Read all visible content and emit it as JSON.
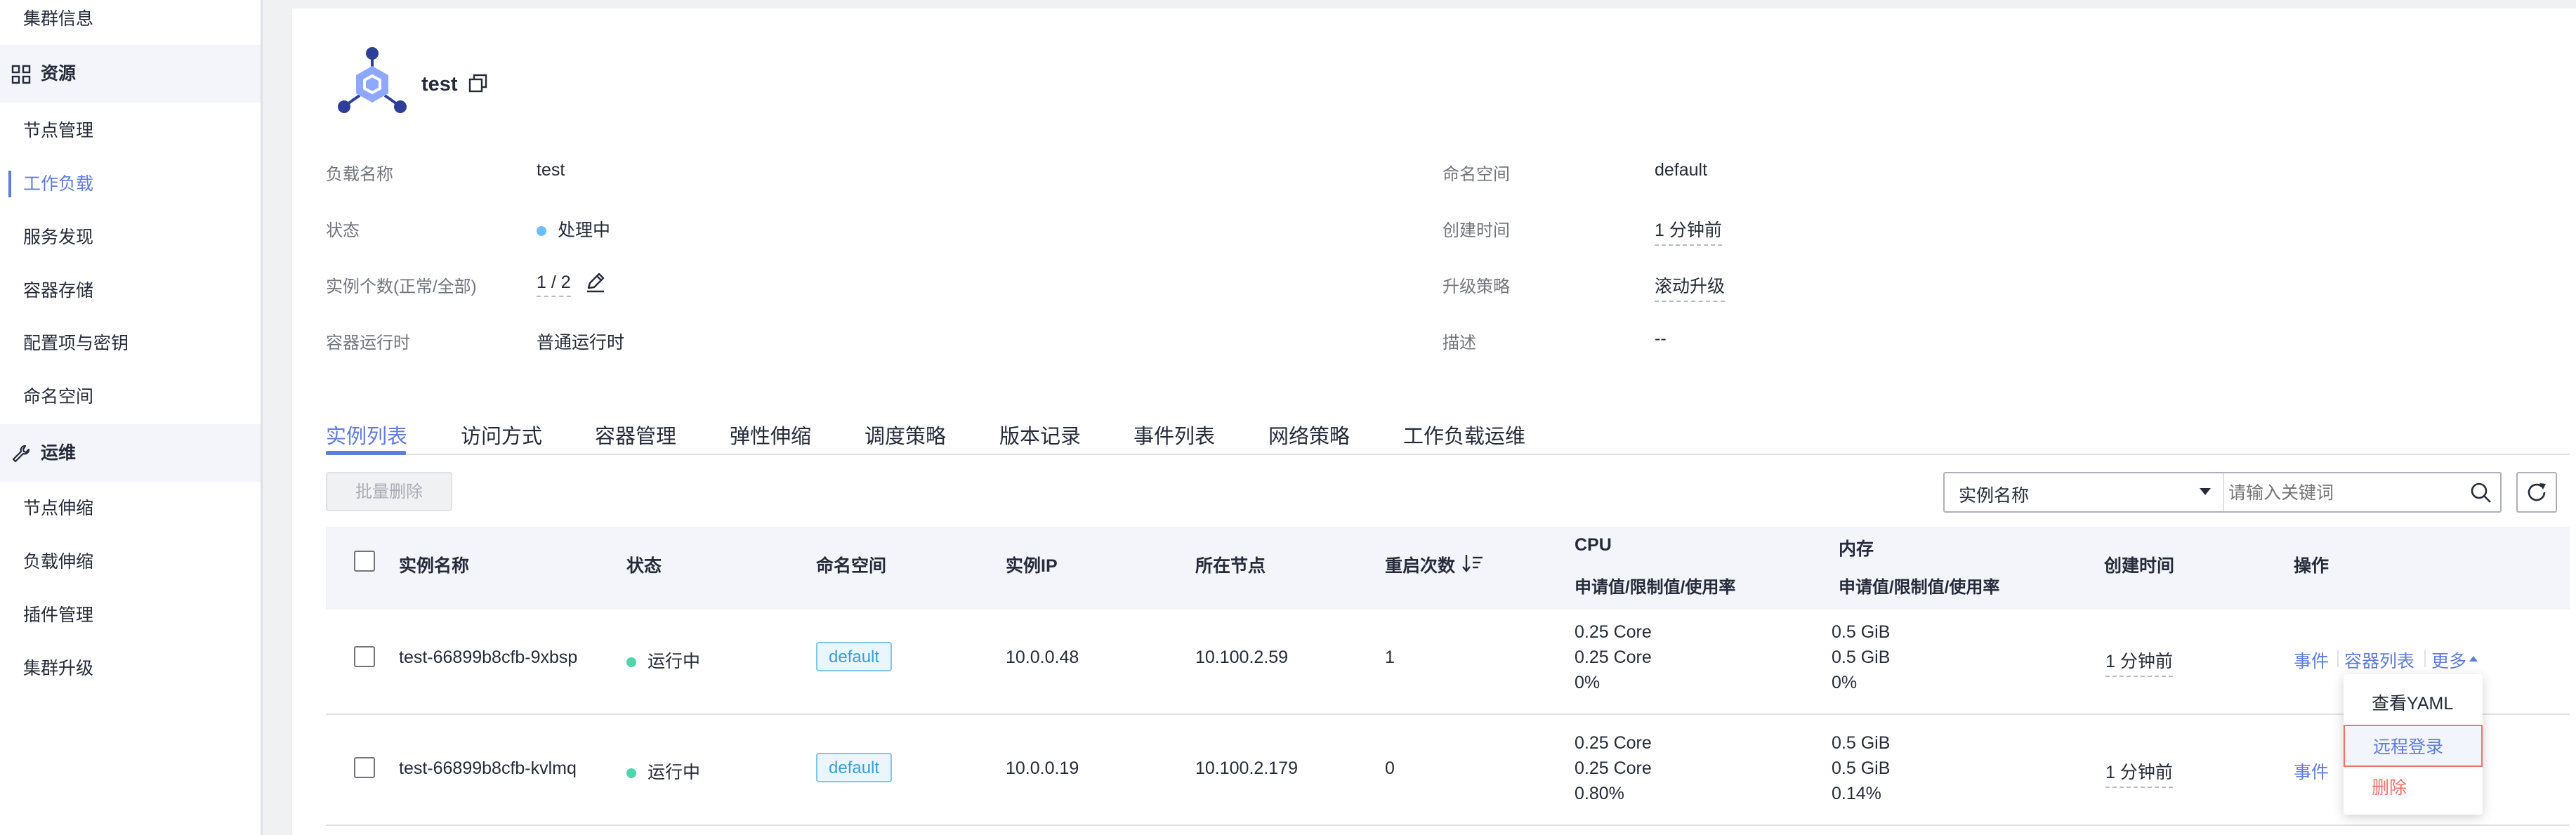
{
  "sidebar": {
    "cluster_info": "集群信息",
    "resources_group": "资源",
    "resources_items": [
      "节点管理",
      "工作负载",
      "服务发现",
      "容器存储",
      "配置项与密钥",
      "命名空间"
    ],
    "ops_group": "运维",
    "ops_items": [
      "节点伸缩",
      "负载伸缩",
      "插件管理",
      "集群升级"
    ]
  },
  "workload": {
    "name": "test",
    "fields": {
      "load_name_label": "负载名称",
      "load_name": "test",
      "status_label": "状态",
      "status": "处理中",
      "instances_label": "实例个数(正常/全部)",
      "instances": "1 / 2",
      "runtime_label": "容器运行时",
      "runtime": "普通运行时",
      "namespace_label": "命名空间",
      "namespace": "default",
      "created_label": "创建时间",
      "created": "1 分钟前",
      "upgrade_label": "升级策略",
      "upgrade": "滚动升级",
      "desc_label": "描述",
      "desc": "--"
    }
  },
  "tabs": [
    "实例列表",
    "访问方式",
    "容器管理",
    "弹性伸缩",
    "调度策略",
    "版本记录",
    "事件列表",
    "网络策略",
    "工作负载运维"
  ],
  "toolbar": {
    "batch_delete": "批量删除",
    "search_type": "实例名称",
    "search_placeholder": "请输入关键词"
  },
  "table": {
    "headers": {
      "name": "实例名称",
      "status": "状态",
      "namespace": "命名空间",
      "ip": "实例IP",
      "node": "所在节点",
      "restarts": "重启次数",
      "cpu": "CPU",
      "cpu_sub": "申请值/限制值/使用率",
      "mem": "内存",
      "mem_sub": "申请值/限制值/使用率",
      "created": "创建时间",
      "actions": "操作"
    },
    "rows": [
      {
        "name": "test-66899b8cfb-9xbsp",
        "status": "运行中",
        "namespace": "default",
        "ip": "10.0.0.48",
        "node": "10.100.2.59",
        "restarts": "1",
        "cpu": [
          "0.25 Core",
          "0.25 Core",
          "0%"
        ],
        "mem": [
          "0.5 GiB",
          "0.5 GiB",
          "0%"
        ],
        "created": "1 分钟前",
        "actions": [
          "事件",
          "容器列表",
          "更多"
        ]
      },
      {
        "name": "test-66899b8cfb-kvlmq",
        "status": "运行中",
        "namespace": "default",
        "ip": "10.0.0.19",
        "node": "10.100.2.179",
        "restarts": "0",
        "cpu": [
          "0.25 Core",
          "0.25 Core",
          "0.80%"
        ],
        "mem": [
          "0.5 GiB",
          "0.5 GiB",
          "0.14%"
        ],
        "created": "1 分钟前",
        "actions": [
          "事件"
        ]
      }
    ]
  },
  "dropdown": {
    "items": [
      "查看YAML",
      "远程登录",
      "删除"
    ]
  },
  "colors": {
    "accent": "#5e7ce0",
    "running": "#50d4ab",
    "processing": "#6cbfff",
    "danger": "#f66f6a"
  }
}
